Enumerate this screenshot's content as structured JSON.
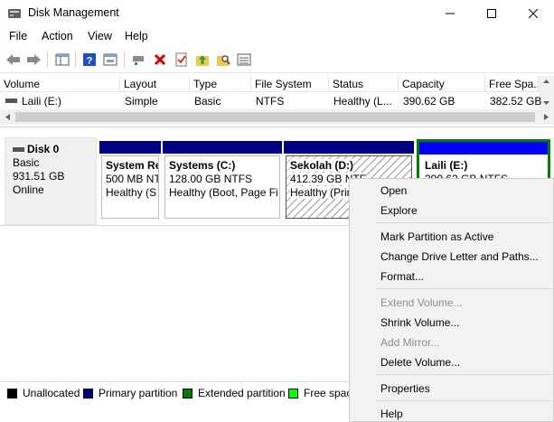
{
  "window": {
    "title": "Disk Management"
  },
  "menu": [
    "File",
    "Action",
    "View",
    "Help"
  ],
  "toolbar": {
    "icons": [
      "back-arrow-icon",
      "forward-arrow-icon",
      "console-tree-icon",
      "help-icon",
      "properties-icon",
      "connect-drive-icon",
      "delete-icon",
      "check-icon",
      "folder-up-icon",
      "search-folder-icon",
      "list-icon"
    ]
  },
  "volume_list": {
    "columns": [
      "Volume",
      "Layout",
      "Type",
      "File System",
      "Status",
      "Capacity",
      "Free Spa..."
    ],
    "rows": [
      {
        "volume": "Laili (E:)",
        "layout": "Simple",
        "type": "Basic",
        "fs": "NTFS",
        "status": "Healthy (L...",
        "capacity": "390.62 GB",
        "free": "382.52 GB"
      }
    ]
  },
  "disk": {
    "name": "Disk 0",
    "kind": "Basic",
    "size": "931.51 GB",
    "state": "Online",
    "partitions": [
      {
        "name": "System Re",
        "detail": "500 MB NT",
        "status": "Healthy (S"
      },
      {
        "name": "Systems  (C:)",
        "detail": "128.00 GB NTFS",
        "status": "Healthy (Boot, Page Fi"
      },
      {
        "name": "Sekolah  (D:)",
        "detail": "412.39 GB NTF",
        "status": "Healthy (Prin"
      },
      {
        "name": "Laili  (E:)",
        "detail": "390.62 GB NTFS",
        "status": ""
      }
    ]
  },
  "legend": [
    {
      "label": "Unallocated",
      "color": "#000000"
    },
    {
      "label": "Primary partition",
      "color": "#000080"
    },
    {
      "label": "Extended partition",
      "color": "#008000"
    },
    {
      "label": "Free spac",
      "color": "#00ff00"
    }
  ],
  "context_menu": {
    "open": "Open",
    "explore": "Explore",
    "mark_active": "Mark Partition as Active",
    "change_letter": "Change Drive Letter and Paths...",
    "format": "Format...",
    "extend": "Extend Volume...",
    "shrink": "Shrink Volume...",
    "add_mirror": "Add Mirror...",
    "delete": "Delete Volume...",
    "properties": "Properties",
    "help": "Help"
  }
}
